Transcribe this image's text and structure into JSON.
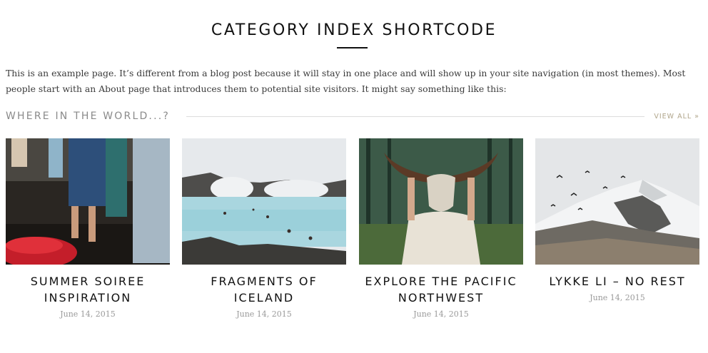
{
  "page": {
    "title": "CATEGORY INDEX SHORTCODE",
    "intro": "This is an example page. It’s different from a blog post because it will stay in one place and will show up in your site navigation (in most themes). Most people start with an About page that introduces them to potential site visitors. It might say something like this:"
  },
  "section": {
    "title": "WHERE IN THE WORLD...?",
    "view_all": "VIEW ALL »"
  },
  "posts": [
    {
      "title": "SUMMER SOIREE INSPIRATION",
      "date": "June 14, 2015",
      "image": "party-photo"
    },
    {
      "title": "FRAGMENTS OF ICELAND",
      "date": "June 14, 2015",
      "image": "hot-spring-photo"
    },
    {
      "title": "EXPLORE THE PACIFIC NORTHWEST",
      "date": "June 14, 2015",
      "image": "skull-horns-photo"
    },
    {
      "title": "LYKKE LI – NO REST",
      "date": "June 14, 2015",
      "image": "mountain-birds-photo"
    }
  ],
  "colors": {
    "accent": "#b0a58a",
    "heading": "#111111",
    "muted": "#8a8a8a"
  }
}
